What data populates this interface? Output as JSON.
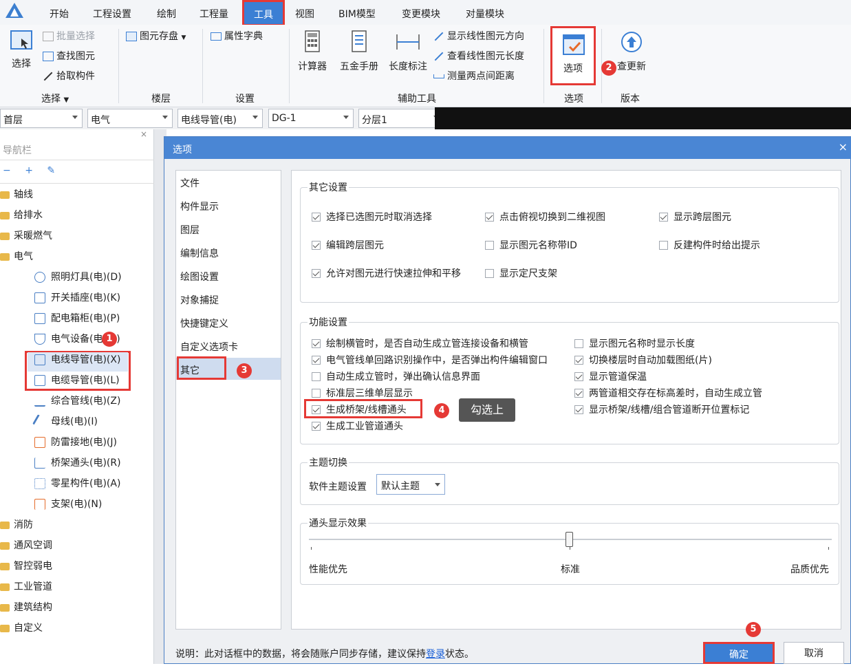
{
  "ribbon_tabs": [
    "开始",
    "工程设置",
    "绘制",
    "工程量",
    "工具",
    "视图",
    "BIM模型",
    "变更模块",
    "对量模块"
  ],
  "ribbon": {
    "select_big": "选择",
    "batch_select": "批量选择",
    "find_element": "查找图元",
    "pick_component": "拾取构件",
    "group_select": "选择",
    "element_save": "图元存盘",
    "group_floor": "楼层",
    "attr_dict": "属性字典",
    "group_settings": "设置",
    "calculator": "计算器",
    "hardware_manual": "五金手册",
    "length_mark": "长度标注",
    "show_direction": "显示线性图元方向",
    "view_length": "查看线性图元长度",
    "measure_distance": "测量两点间距离",
    "group_aux": "辅助工具",
    "options": "选项",
    "group_options": "选项",
    "check_update": "查更新",
    "group_version": "版本"
  },
  "selectors": [
    "首层",
    "电气",
    "电线导管(电)",
    "DG-1",
    "分层1"
  ],
  "nav": {
    "title": "导航栏",
    "folders_top": [
      "轴线",
      "给排水",
      "采暖燃气",
      "电气"
    ],
    "electric_items": [
      "照明灯具(电)(D)",
      "开关插座(电)(K)",
      "配电箱柜(电)(P)",
      "电气设备(电)(S)",
      "电线导管(电)(X)",
      "电缆导管(电)(L)",
      "综合管线(电)(Z)",
      "母线(电)(I)",
      "防雷接地(电)(J)",
      "桥架通头(电)(R)",
      "零星构件(电)(A)",
      "支架(电)(N)"
    ],
    "folders_bottom": [
      "消防",
      "通风空调",
      "智控弱电",
      "工业管道",
      "建筑结构",
      "自定义"
    ]
  },
  "dialog": {
    "title": "选项",
    "left_items": [
      "文件",
      "构件显示",
      "图层",
      "编制信息",
      "绘图设置",
      "对象捕捉",
      "快捷键定义",
      "自定义选项卡",
      "其它"
    ],
    "group_other": "其它设置",
    "other_opts": [
      {
        "label": "选择已选图元时取消选择",
        "checked": true
      },
      {
        "label": "点击俯视切换到二维视图",
        "checked": true
      },
      {
        "label": "显示跨层图元",
        "checked": true
      },
      {
        "label": "编辑跨层图元",
        "checked": true
      },
      {
        "label": "显示图元名称带ID",
        "checked": false
      },
      {
        "label": "反建构件时给出提示",
        "checked": false
      },
      {
        "label": "允许对图元进行快速拉伸和平移",
        "checked": true
      },
      {
        "label": "显示定尺支架",
        "checked": false
      }
    ],
    "group_func": "功能设置",
    "func_opts": [
      {
        "label": "绘制横管时，是否自动生成立管连接设备和横管",
        "checked": true
      },
      {
        "label": "显示图元名称时显示长度",
        "checked": false
      },
      {
        "label": "电气管线单回路识别操作中，是否弹出构件编辑窗口",
        "checked": true
      },
      {
        "label": "切换楼层时自动加载图纸(片)",
        "checked": true
      },
      {
        "label": "自动生成立管时，弹出确认信息界面",
        "checked": false
      },
      {
        "label": "显示管道保温",
        "checked": true
      },
      {
        "label": "标准层三维单层显示",
        "checked": false
      },
      {
        "label": "两管道相交存在标高差时，自动生成立管",
        "checked": true
      },
      {
        "label": "生成桥架/线槽通头",
        "checked": true
      },
      {
        "label": "显示桥架/线槽/组合管道断开位置标记",
        "checked": true
      },
      {
        "label": "生成工业管道通头",
        "checked": true
      }
    ],
    "group_theme": "主题切换",
    "theme_label": "软件主题设置",
    "theme_value": "默认主题",
    "group_joint": "通头显示效果",
    "slider_left": "性能优先",
    "slider_mid": "标准",
    "slider_right": "品质优先",
    "slider_level": 0.5,
    "note_prefix": "说明：此对话框中的数据，将会随账户同步存储，建议保持",
    "note_link": "登录",
    "note_suffix": "状态。",
    "ok": "确定",
    "cancel": "取消",
    "tooltip": "勾选上"
  },
  "badges": [
    "1",
    "2",
    "3",
    "4",
    "5"
  ],
  "colors": {
    "accent": "#4a86d4",
    "highlight": "#e53935"
  }
}
